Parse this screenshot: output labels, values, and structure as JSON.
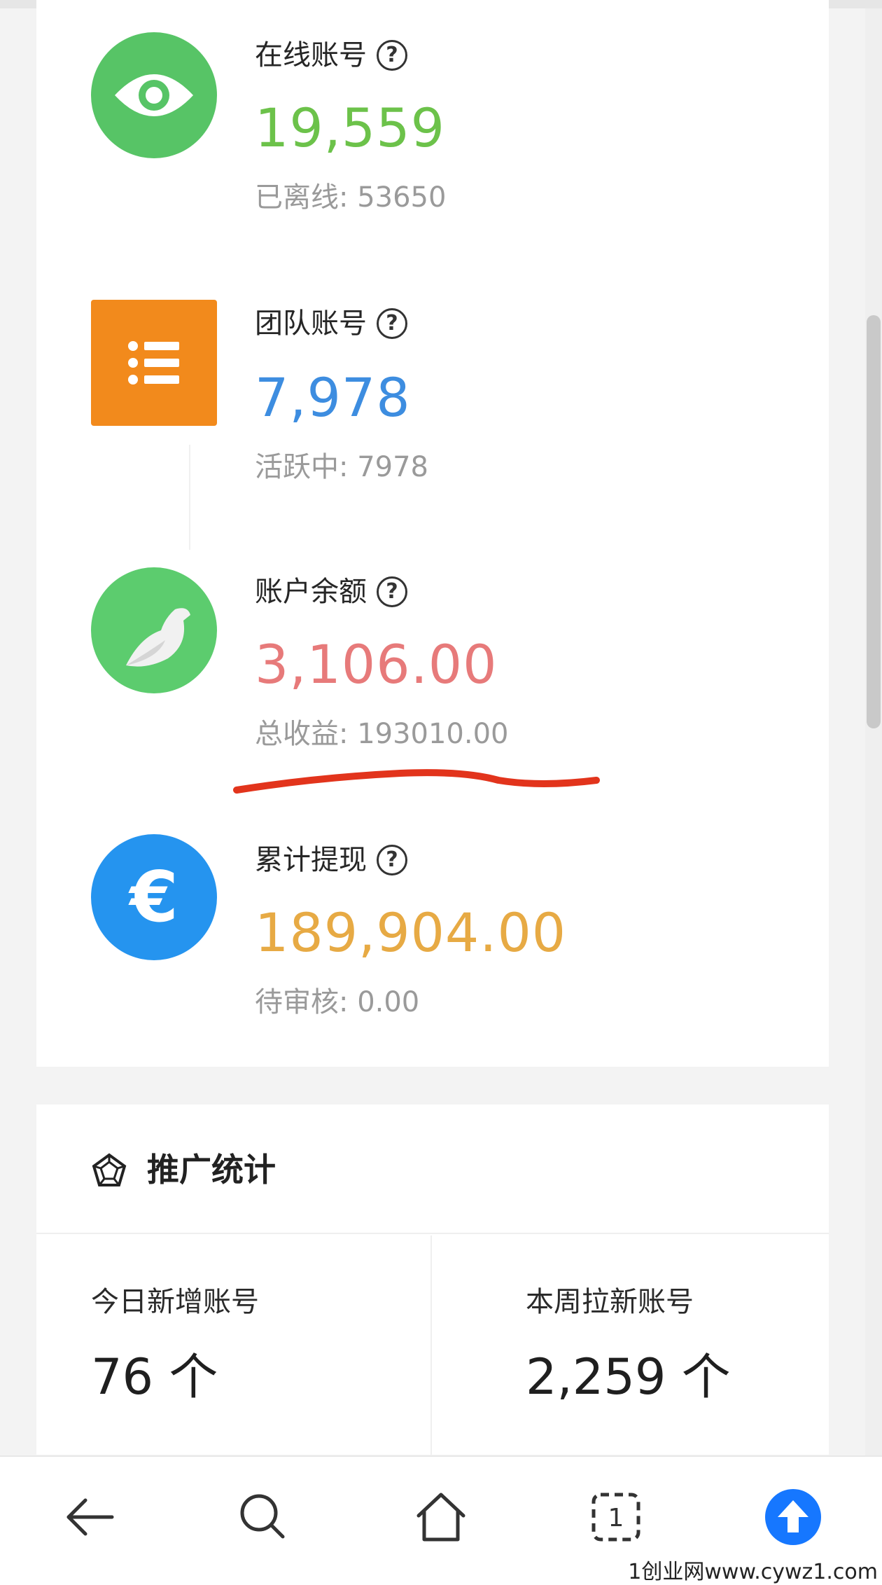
{
  "stats": [
    {
      "title": "在线账号",
      "value": "19,559",
      "sub": "已离线: 53650",
      "value_color": "#6cc24a",
      "icon": "eye-icon",
      "icon_color": "#57c466"
    },
    {
      "title": "团队账号",
      "value": "7,978",
      "sub": "活跃中: 7978",
      "value_color": "#3d8de0",
      "icon": "list-icon",
      "icon_color": "#f28a1c"
    },
    {
      "title": "账户余额",
      "value": "3,106.00",
      "sub": "总收益: 193010.00",
      "value_color": "#e77a7a",
      "icon": "bird-icon",
      "icon_color": "#5ccc6e"
    },
    {
      "title": "累计提现",
      "value": "189,904.00",
      "sub": "待审核: 0.00",
      "value_color": "#e7aa44",
      "icon": "euro-icon",
      "icon_color": "#2594ef"
    }
  ],
  "help_glyph": "?",
  "euro_glyph": "€",
  "promo": {
    "title": "推广统计",
    "items": [
      {
        "label": "今日新增账号",
        "value": "76 个"
      },
      {
        "label": "本周拉新账号",
        "value": "2,259 个"
      }
    ]
  },
  "nav": {
    "tab_count": "1",
    "items": [
      "back-icon",
      "search-icon",
      "home-icon",
      "tabs-icon",
      "upload-icon"
    ],
    "accent": "#1677ff"
  },
  "watermark": "1创业网www.cywz1.com"
}
